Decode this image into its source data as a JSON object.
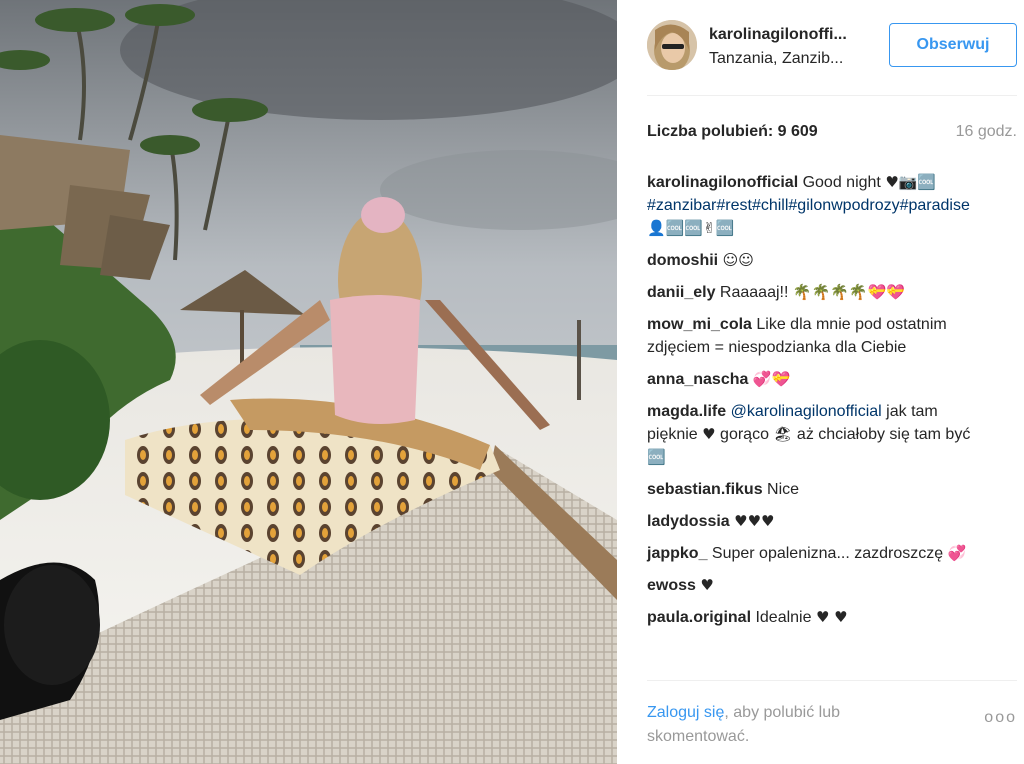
{
  "post": {
    "user": "karolinagilonoffi...",
    "location": "Tanzania, Zanzib...",
    "follow_label": "Obserwuj",
    "likes": "Liczba polubień: 9 609",
    "time": "16 godz."
  },
  "comments": [
    {
      "user": "karolinagilonofficial",
      "text": " Good night ",
      "emoji": "♥📷🆒",
      "hashtags": "#zanzibar#rest#chill#gilonwpodrozy#paradise",
      "emoji2": " 👤🆒🆒✌🆒"
    },
    {
      "user": "domoshii",
      "text": " ",
      "emoji": "☺☺"
    },
    {
      "user": "danii_ely",
      "text": " Raaaaaj!! ",
      "emoji": "🌴🌴🌴🌴💝💝"
    },
    {
      "user": "mow_mi_cola",
      "text": " Like dla mnie pod ostatnim zdjęciem = niespodzianka dla Ciebie"
    },
    {
      "user": "anna_nascha",
      "text": " ",
      "emoji": "💞💝"
    },
    {
      "user": "magda.life",
      "mention": "@karolinagilonofficial",
      "text": " jak tam pięknie ",
      "emoji": "♥",
      "text2": " gorąco ",
      "emoji2": "🏖",
      "text3": " aż chciałoby się tam być ",
      "emoji3": "🆒"
    },
    {
      "user": "sebastian.fikus",
      "text": " Nice"
    },
    {
      "user": "ladydossia",
      "text": " ",
      "emoji": "♥♥♥"
    },
    {
      "user": "jappko_",
      "text": " Super opalenizna... zazdroszczę ",
      "emoji": "💞"
    },
    {
      "user": "ewoss",
      "text": " ",
      "emoji": "♥"
    },
    {
      "user": "paula.original",
      "text": " Idealnie ",
      "emoji": "♥ ♥"
    }
  ],
  "footer": {
    "login_link": "Zaloguj się",
    "login_rest": ", aby polubić lub skomentować.",
    "more": "ooo"
  }
}
